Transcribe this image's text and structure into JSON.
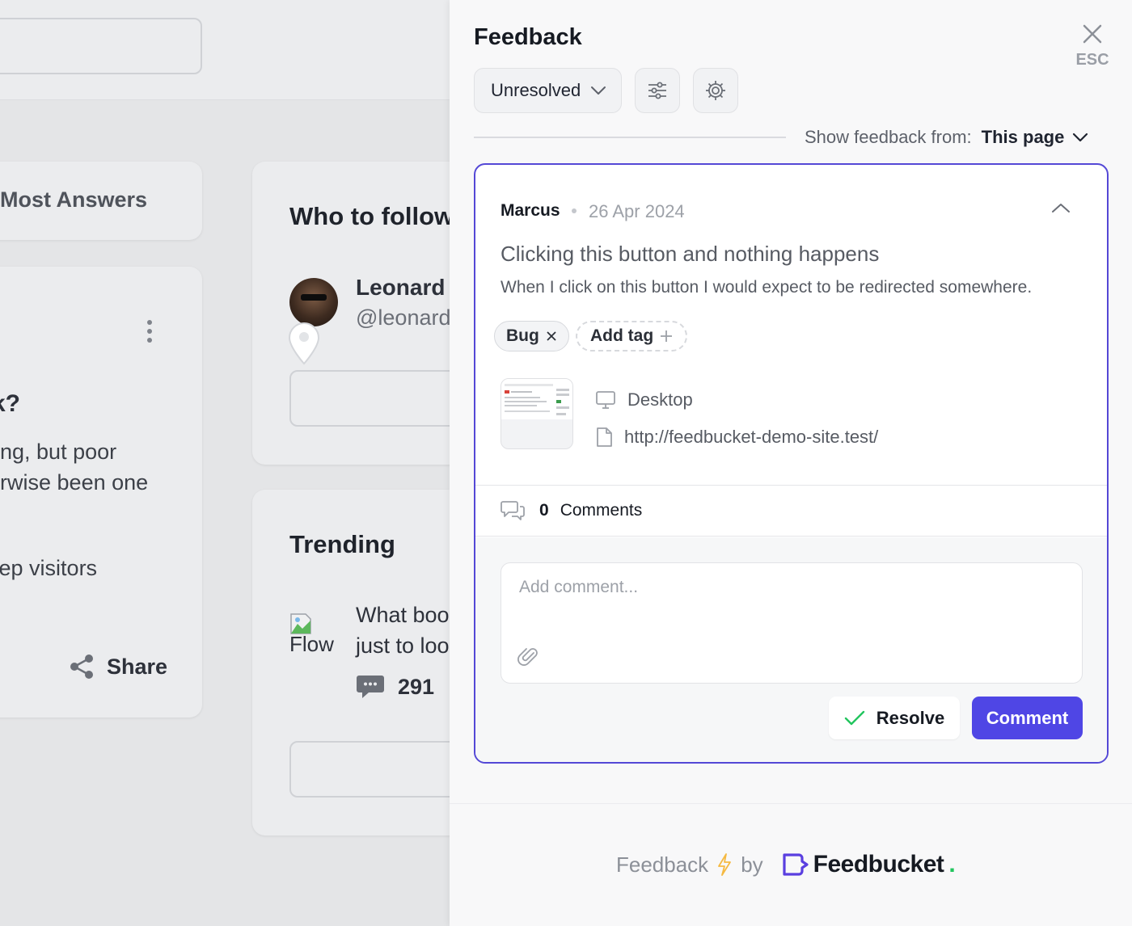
{
  "background": {
    "most_answers_title": "Most Answers",
    "post_question": "k?",
    "post_line1": "ering, but poor",
    "post_line2": "nerwise been one",
    "post_line3": "keep visitors",
    "share_label": "Share",
    "who_to_follow_title": "Who to follow",
    "follow_name": "Leonard K",
    "follow_handle": "@leonard",
    "trending_title": "Trending",
    "trend_img_alt": "Flow",
    "trend_line1": "What boo",
    "trend_line2": "just to loo",
    "trend_comment_count": "291"
  },
  "panel": {
    "title": "Feedback",
    "close_label": "ESC",
    "status_filter": "Unresolved",
    "show_from_label": "Show feedback from:",
    "show_from_value": "This page"
  },
  "feedback": {
    "author": "Marcus",
    "date": "26 Apr 2024",
    "title": "Clicking this button and nothing happens",
    "description": "When I click on this button I would expect to be redirected somewhere.",
    "tags": [
      "Bug"
    ],
    "add_tag_label": "Add tag",
    "device": "Desktop",
    "url": "http://feedbucket-demo-site.test/",
    "comment_count": "0",
    "comments_label": "Comments",
    "comment_placeholder": "Add comment...",
    "resolve_label": "Resolve",
    "comment_button_label": "Comment"
  },
  "footer": {
    "text_before": "Feedback",
    "text_by": "by",
    "brand": "Feedbucket",
    "brand_dot": "."
  },
  "colors": {
    "accent": "#4f46e5",
    "card_border": "#5448d6",
    "resolve_check": "#22c55e",
    "bolt": "#f5b942"
  },
  "icons": [
    "close-icon",
    "chevron-down-icon",
    "sliders-icon",
    "gear-icon",
    "chevron-up-icon",
    "desktop-icon",
    "file-icon",
    "comments-icon",
    "paperclip-icon",
    "check-icon",
    "bolt-icon",
    "share-icon",
    "chat-bubble-icon",
    "map-pin-icon"
  ]
}
